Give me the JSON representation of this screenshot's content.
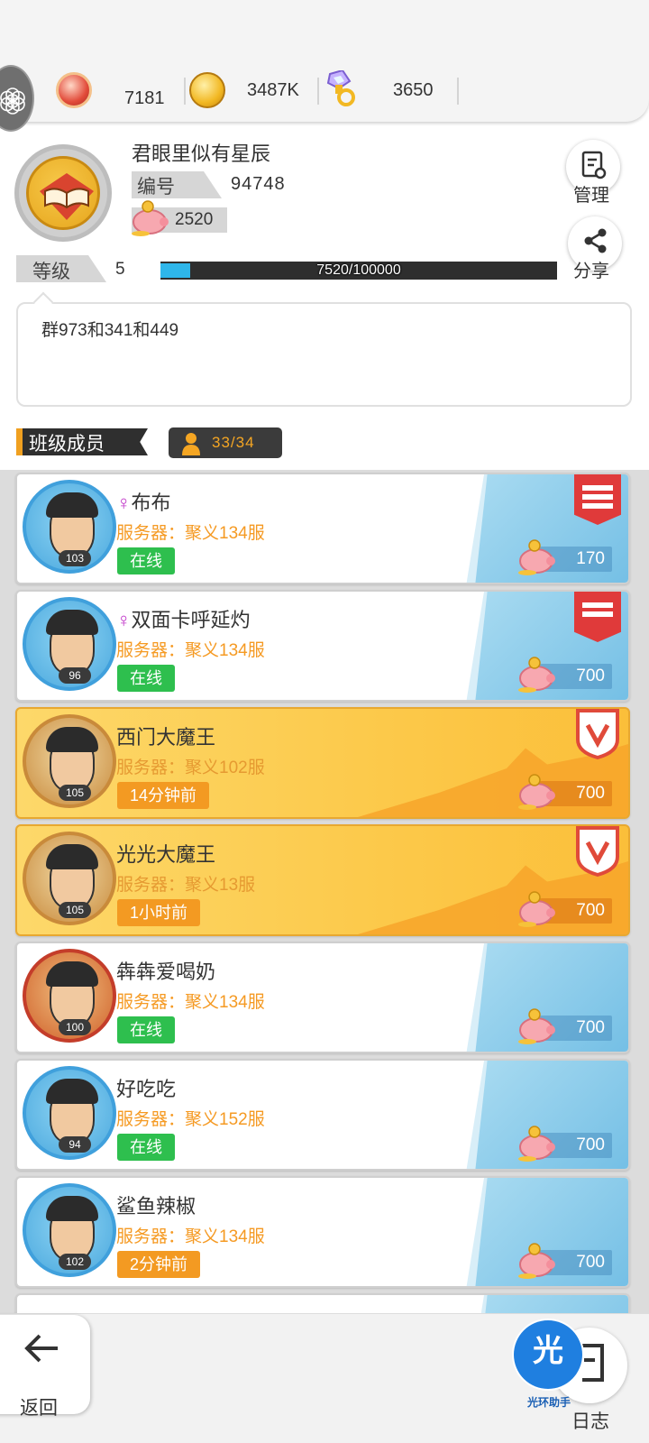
{
  "currency": [
    {
      "icon": "red-gem-coin-icon",
      "value": "7181"
    },
    {
      "icon": "gold-coin-icon",
      "value": "3487K"
    },
    {
      "icon": "crystal-pacifier-icon",
      "value": "3650"
    }
  ],
  "profile": {
    "name": "君眼里似有星辰",
    "id_label": "编号",
    "id_value": "94748",
    "piggy_value": "2520",
    "level_label": "等级",
    "level_value": "5",
    "xp_text": "7520/100000",
    "xp_progress": 0.0752,
    "notice": "群973和341和449",
    "manage_label": "管理",
    "share_label": "分享"
  },
  "section": {
    "title": "班级成员",
    "member_count": "33/34"
  },
  "members": [
    {
      "female": true,
      "female_symbol": "♀",
      "name": "布布",
      "server": "服务器：聚义134服",
      "status": "在线",
      "online": true,
      "level": "103",
      "points": "170",
      "style": "white",
      "rank": "red-banner-3"
    },
    {
      "female": true,
      "female_symbol": "♀",
      "name": "双面卡呼延灼",
      "server": "服务器：聚义134服",
      "status": "在线",
      "online": true,
      "level": "96",
      "points": "700",
      "style": "white",
      "rank": "red-banner-2"
    },
    {
      "female": false,
      "female_symbol": "",
      "name": "西门大魔王",
      "server": "服务器：聚义102服",
      "status": "14分钟前",
      "online": false,
      "level": "105",
      "points": "700",
      "style": "orange",
      "rank": "red-shield"
    },
    {
      "female": false,
      "female_symbol": "",
      "name": "光光大魔王",
      "server": "服务器：聚义13服",
      "status": "1小时前",
      "online": false,
      "level": "105",
      "points": "700",
      "style": "orange",
      "rank": "red-shield"
    },
    {
      "female": false,
      "female_symbol": "",
      "name": "犇犇爱喝奶",
      "server": "服务器：聚义134服",
      "status": "在线",
      "online": true,
      "level": "100",
      "points": "700",
      "style": "white",
      "rank": ""
    },
    {
      "female": false,
      "female_symbol": "",
      "name": "好吃吃",
      "server": "服务器：聚义152服",
      "status": "在线",
      "online": true,
      "level": "94",
      "points": "700",
      "style": "white",
      "rank": ""
    },
    {
      "female": false,
      "female_symbol": "",
      "name": "鲨鱼辣椒",
      "server": "服务器：聚义134服",
      "status": "2分钟前",
      "online": false,
      "level": "102",
      "points": "700",
      "style": "white",
      "rank": ""
    }
  ],
  "bottom": {
    "back_label": "返回",
    "log_label": "日志",
    "helper_glyph": "光",
    "helper_label": "光环助手"
  },
  "colors": {
    "online": "#2ebf4e",
    "offline": "#f39a22",
    "server_text": "#f59a23",
    "xp_fill": "#2eb6ea"
  }
}
